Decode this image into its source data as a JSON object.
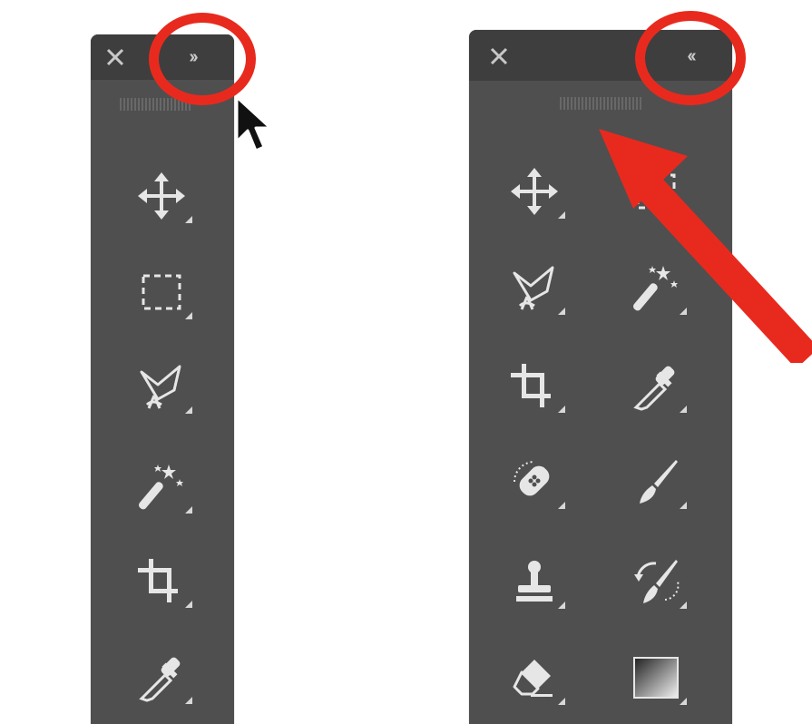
{
  "left_panel": {
    "close_glyph": "✕",
    "toggle_glyph": "››",
    "tools": [
      {
        "icon": "move-icon"
      },
      {
        "icon": "rectangular-marquee-icon"
      },
      {
        "icon": "lasso-icon"
      },
      {
        "icon": "magic-wand-icon"
      },
      {
        "icon": "crop-icon"
      },
      {
        "icon": "eyedropper-icon"
      }
    ]
  },
  "right_panel": {
    "close_glyph": "✕",
    "toggle_glyph": "‹‹",
    "tools": [
      {
        "icon": "move-icon"
      },
      {
        "icon": "rectangular-marquee-icon"
      },
      {
        "icon": "lasso-icon"
      },
      {
        "icon": "magic-wand-icon"
      },
      {
        "icon": "crop-icon"
      },
      {
        "icon": "eyedropper-icon"
      },
      {
        "icon": "healing-brush-icon"
      },
      {
        "icon": "brush-icon"
      },
      {
        "icon": "clone-stamp-icon"
      },
      {
        "icon": "history-brush-icon"
      },
      {
        "icon": "eraser-icon"
      },
      {
        "icon": "gradient-icon"
      }
    ]
  },
  "colors": {
    "panel": "#4f4f4f",
    "titlebar": "#3e3e3e",
    "icon": "#e6e6e6",
    "annotation": "#e82a1e"
  }
}
